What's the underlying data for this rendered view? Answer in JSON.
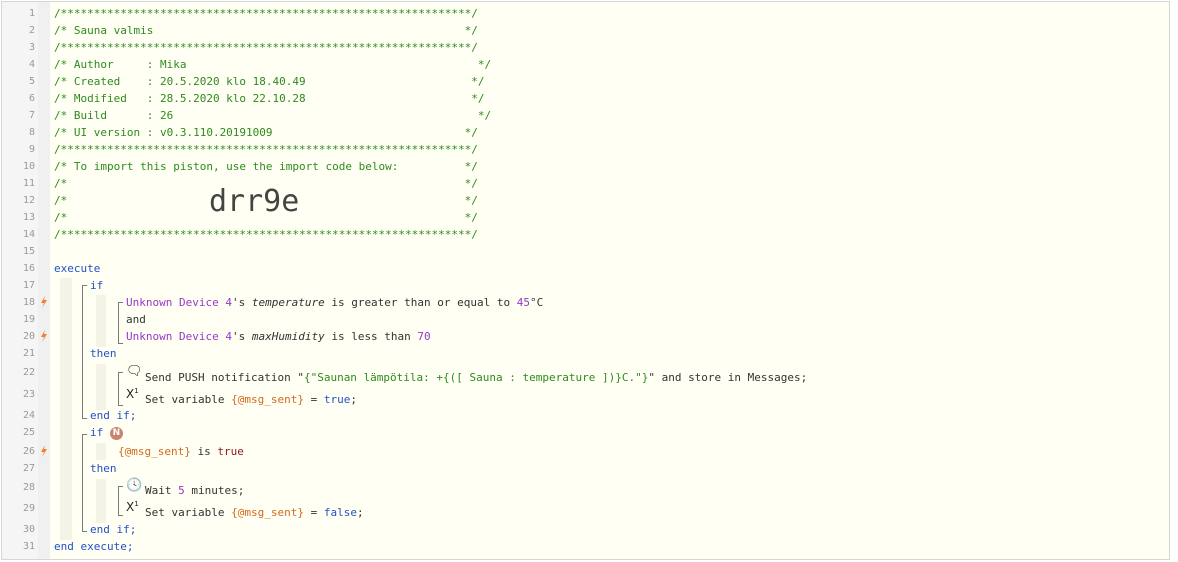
{
  "gutter": {
    "line_numbers": [
      "1",
      "2",
      "3",
      "4",
      "5",
      "6",
      "7",
      "8",
      "9",
      "10",
      "11",
      "12",
      "13",
      "14",
      "15",
      "16",
      "17",
      "18",
      "19",
      "20",
      "21",
      "22",
      "23",
      "24",
      "25",
      "26",
      "27",
      "28",
      "29",
      "30",
      "31"
    ]
  },
  "header": {
    "border": "/**************************************************************/",
    "title": "/* Sauna valmis                                               */",
    "author": "/* Author     : Mika                                            */",
    "created": "/* Created    : 20.5.2020 klo 18.40.49                         */",
    "modified": "/* Modified   : 28.5.2020 klo 22.10.28                         */",
    "build": "/* Build      : 26                                              */",
    "ui_version": "/* UI version : v0.3.110.20191009                             */",
    "import_note": "/* To import this piston, use the import code below:          */",
    "blank": "/*                                                            */",
    "import_code": "drr9e"
  },
  "code": {
    "execute": "execute",
    "if_1": "if",
    "cond1": {
      "device": "Unknown Device 4",
      "possessive": "'s ",
      "attr": "temperature",
      "op": " is greater than or equal to ",
      "value": "45",
      "unit": "°C"
    },
    "and": "and",
    "cond2": {
      "device": "Unknown Device 4",
      "possessive": "'s ",
      "attr": "maxHumidity",
      "op": " is less than ",
      "value": "70"
    },
    "then_1": "then",
    "push": {
      "prefix": "Send PUSH notification \"",
      "msg": "{\"Saunan lämpötila: +{([ Sauna : temperature ])}C.\"}",
      "suffix": "\" and store in Messages;"
    },
    "setvar1": {
      "prefix": "Set variable ",
      "var": "{@msg_sent}",
      "eq": " = ",
      "value": "true",
      "end": ";"
    },
    "endif_1": "end if;",
    "if_2": "if",
    "if_2_badge": "N",
    "cond3": {
      "var": "{@msg_sent}",
      "op": " is ",
      "value": "true"
    },
    "then_2": "then",
    "wait": {
      "prefix": "Wait ",
      "value": "5",
      "suffix": " minutes;"
    },
    "setvar2": {
      "prefix": "Set variable ",
      "var": "{@msg_sent}",
      "eq": " = ",
      "value": "false",
      "end": ";"
    },
    "endif_2": "end if;",
    "end_execute": "end execute;"
  },
  "colors": {
    "comment": "#2e8b1e",
    "keyword": "#2350c8",
    "device": "#9538c9",
    "variable": "#d2691e",
    "bolt": "#f08030"
  },
  "icons": [
    "lightning-bolt-icon",
    "speech-bubble-icon",
    "set-variable-icon",
    "clock-icon"
  ]
}
